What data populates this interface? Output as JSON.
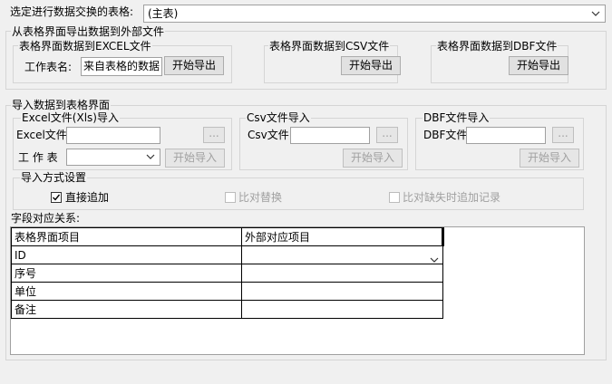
{
  "select_table": {
    "label": "选定进行数据交换的表格:",
    "value": "(主表)"
  },
  "export": {
    "title": "从表格界面导出数据到外部文件",
    "excel": {
      "title": "表格界面数据到EXCEL文件",
      "sheet_label": "工作表名:",
      "sheet_value": "来自表格的数据",
      "button": "开始导出"
    },
    "csv": {
      "title": "表格界面数据到CSV文件",
      "button": "开始导出"
    },
    "dbf": {
      "title": "表格界面数据到DBF文件",
      "button": "开始导出"
    }
  },
  "import": {
    "title": "导入数据到表格界面",
    "excel": {
      "title": "Excel文件(Xls)导入",
      "file_label": "Excel文件",
      "browse": "...",
      "sheet_label": "工 作 表",
      "button": "开始导入"
    },
    "csv": {
      "title": "Csv文件导入",
      "file_label": "Csv文件",
      "browse": "...",
      "button": "开始导入"
    },
    "dbf": {
      "title": "DBF文件导入",
      "file_label": "DBF文件",
      "browse": "...",
      "button": "开始导入"
    },
    "mode": {
      "title": "导入方式设置",
      "options": [
        {
          "label": "直接追加",
          "checked": true,
          "enabled": true
        },
        {
          "label": "比对替换",
          "checked": false,
          "enabled": false
        },
        {
          "label": "比对缺失时追加记录",
          "checked": false,
          "enabled": false
        }
      ]
    }
  },
  "mapping": {
    "label": "字段对应关系:",
    "headers": [
      "表格界面项目",
      "外部对应项目"
    ],
    "rows": [
      {
        "field": "ID",
        "external": ""
      },
      {
        "field": "序号",
        "external": ""
      },
      {
        "field": "单位",
        "external": ""
      },
      {
        "field": "备注",
        "external": ""
      }
    ]
  }
}
